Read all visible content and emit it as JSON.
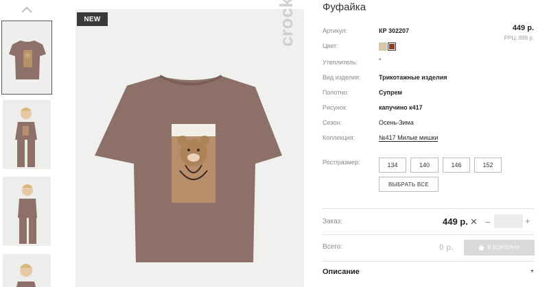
{
  "gallery": {
    "badge": "NEW",
    "brand": "crockid",
    "accent_shirt": "#8d7168",
    "thumbnail_count": 4
  },
  "product": {
    "title": "Фуфайка",
    "price": "449 р.",
    "rrp": "РРЦ: 899 р."
  },
  "attributes": [
    {
      "label": "Артикул:",
      "value": "КР 302207"
    },
    {
      "label": "Цвет:",
      "value": ""
    },
    {
      "label": "Утеплитель:",
      "value": "\""
    },
    {
      "label": "Вид изделия:",
      "value": "Трикотажные изделия"
    },
    {
      "label": "Полотно:",
      "value": "Супрем"
    },
    {
      "label": "Рисунок:",
      "value": "капучино к417"
    },
    {
      "label": "Сезон:",
      "value": "Осень-Зима"
    },
    {
      "label": "Коллекция:",
      "value": "№417 Милые мишки"
    },
    {
      "label": "Рост/размер:",
      "value": ""
    }
  ],
  "colors": [
    "#d6c8a8",
    "#8e3f2a"
  ],
  "sizes": [
    "134",
    "140",
    "146",
    "152"
  ],
  "select_all_label": "ВЫБРАТЬ ВСЕ",
  "order": {
    "label": "Заказ:",
    "price": "449 р.",
    "remove": "✕",
    "minus": "–",
    "plus": "+",
    "quantity": ""
  },
  "total": {
    "label": "Всего:",
    "value": "0 р.",
    "cart_button": "В КОРЗИНУ"
  },
  "description": {
    "label": "Описание"
  }
}
